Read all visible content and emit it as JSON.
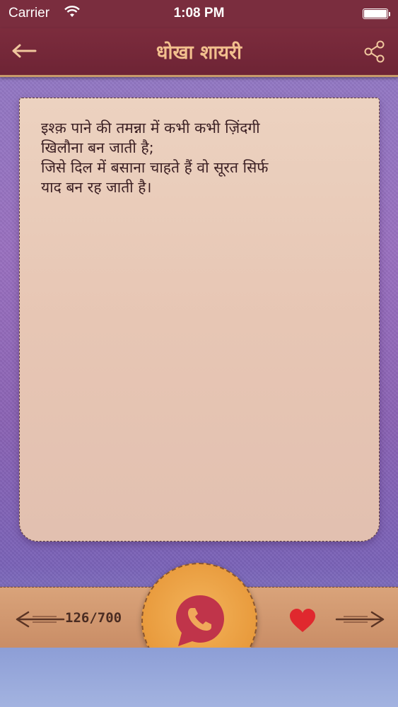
{
  "status_bar": {
    "carrier": "Carrier",
    "time": "1:08 PM",
    "wifi_icon": "wifi-icon",
    "battery_icon": "battery-icon"
  },
  "nav": {
    "title": "धोखा शायरी",
    "back_icon": "back-arrow-icon",
    "share_icon": "share-icon"
  },
  "card": {
    "text": "इश्क़ पाने की तमन्ना में कभी कभी ज़िंदगी\nखिलौना बन जाती है;\nजिसे दिल में बसाना चाहते हैं वो सूरत सिर्फ\nयाद बन रह जाती है।"
  },
  "bottom": {
    "counter": "126/700",
    "prev_icon": "left-arrow-icon",
    "next_icon": "right-arrow-icon",
    "whatsapp_icon": "whatsapp-icon",
    "favorite_icon": "heart-icon"
  },
  "colors": {
    "header": "#7a2d3e",
    "title": "#f2c08e",
    "heart": "#e0282e",
    "whatsapp": "#c0344a"
  }
}
